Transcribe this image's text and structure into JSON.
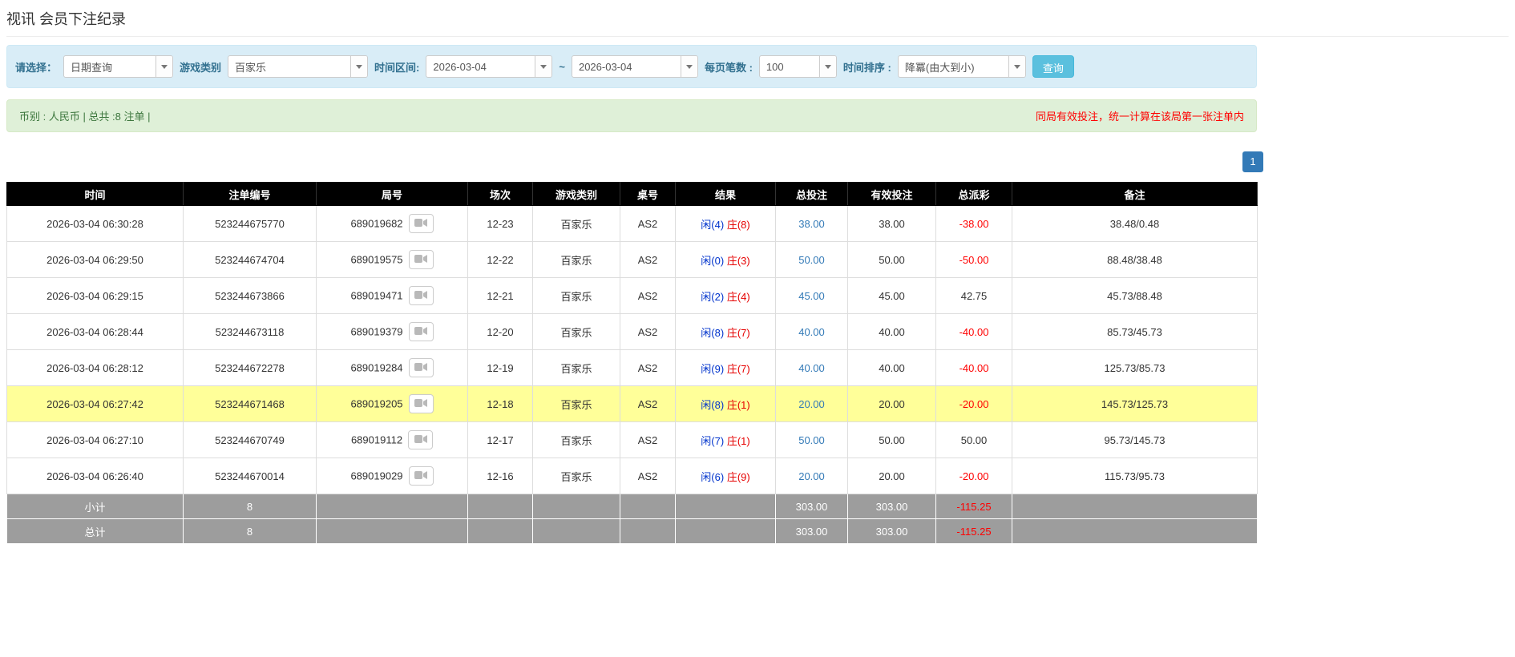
{
  "page": {
    "title": "视讯 会员下注纪录"
  },
  "filters": {
    "select_label": "请选择：",
    "select_value": "日期查询",
    "game_type_label": "游戏类别",
    "game_type_value": "百家乐",
    "time_range_label": "时间区间:",
    "date_from": "2026-03-04",
    "tilde": "~",
    "date_to": "2026-03-04",
    "page_size_label": "每页笔数 :",
    "page_size_value": "100",
    "sort_label": "时间排序 :",
    "sort_value": "降冪(由大到小)",
    "search_button": "查询"
  },
  "info_bar": {
    "left": "币别 : 人民币 | 总共 :8 注单 |",
    "right": "同局有效投注，统一计算在该局第一张注单内"
  },
  "pagination": {
    "pages": [
      "1"
    ]
  },
  "table": {
    "headers": [
      "时间",
      "注单编号",
      "局号",
      "场次",
      "游戏类别",
      "桌号",
      "结果",
      "总投注",
      "有效投注",
      "总派彩",
      "备注"
    ],
    "rows": [
      {
        "time": "2026-03-04 06:30:28",
        "bet_id": "523244675770",
        "round_id": "689019682",
        "session": "12-23",
        "game_type": "百家乐",
        "table_no": "AS2",
        "result_player": "闲(4)",
        "result_banker": "庄(8)",
        "total_bet": "38.00",
        "valid_bet": "38.00",
        "payout": "-38.00",
        "remark": "38.48/0.48",
        "highlighted": false
      },
      {
        "time": "2026-03-04 06:29:50",
        "bet_id": "523244674704",
        "round_id": "689019575",
        "session": "12-22",
        "game_type": "百家乐",
        "table_no": "AS2",
        "result_player": "闲(0)",
        "result_banker": "庄(3)",
        "total_bet": "50.00",
        "valid_bet": "50.00",
        "payout": "-50.00",
        "remark": "88.48/38.48",
        "highlighted": false
      },
      {
        "time": "2026-03-04 06:29:15",
        "bet_id": "523244673866",
        "round_id": "689019471",
        "session": "12-21",
        "game_type": "百家乐",
        "table_no": "AS2",
        "result_player": "闲(2)",
        "result_banker": "庄(4)",
        "total_bet": "45.00",
        "valid_bet": "45.00",
        "payout": "42.75",
        "remark": "45.73/88.48",
        "highlighted": false
      },
      {
        "time": "2026-03-04 06:28:44",
        "bet_id": "523244673118",
        "round_id": "689019379",
        "session": "12-20",
        "game_type": "百家乐",
        "table_no": "AS2",
        "result_player": "闲(8)",
        "result_banker": "庄(7)",
        "total_bet": "40.00",
        "valid_bet": "40.00",
        "payout": "-40.00",
        "remark": "85.73/45.73",
        "highlighted": false
      },
      {
        "time": "2026-03-04 06:28:12",
        "bet_id": "523244672278",
        "round_id": "689019284",
        "session": "12-19",
        "game_type": "百家乐",
        "table_no": "AS2",
        "result_player": "闲(9)",
        "result_banker": "庄(7)",
        "total_bet": "40.00",
        "valid_bet": "40.00",
        "payout": "-40.00",
        "remark": "125.73/85.73",
        "highlighted": false
      },
      {
        "time": "2026-03-04 06:27:42",
        "bet_id": "523244671468",
        "round_id": "689019205",
        "session": "12-18",
        "game_type": "百家乐",
        "table_no": "AS2",
        "result_player": "闲(8)",
        "result_banker": "庄(1)",
        "total_bet": "20.00",
        "valid_bet": "20.00",
        "payout": "-20.00",
        "remark": "145.73/125.73",
        "highlighted": true
      },
      {
        "time": "2026-03-04 06:27:10",
        "bet_id": "523244670749",
        "round_id": "689019112",
        "session": "12-17",
        "game_type": "百家乐",
        "table_no": "AS2",
        "result_player": "闲(7)",
        "result_banker": "庄(1)",
        "total_bet": "50.00",
        "valid_bet": "50.00",
        "payout": "50.00",
        "remark": "95.73/145.73",
        "highlighted": false
      },
      {
        "time": "2026-03-04 06:26:40",
        "bet_id": "523244670014",
        "round_id": "689019029",
        "session": "12-16",
        "game_type": "百家乐",
        "table_no": "AS2",
        "result_player": "闲(6)",
        "result_banker": "庄(9)",
        "total_bet": "20.00",
        "valid_bet": "20.00",
        "payout": "-20.00",
        "remark": "115.73/95.73",
        "highlighted": false
      }
    ],
    "subtotal": {
      "label": "小计",
      "count": "8",
      "total_bet": "303.00",
      "valid_bet": "303.00",
      "payout": "-115.25"
    },
    "total": {
      "label": "总计",
      "count": "8",
      "total_bet": "303.00",
      "valid_bet": "303.00",
      "payout": "-115.25"
    }
  }
}
